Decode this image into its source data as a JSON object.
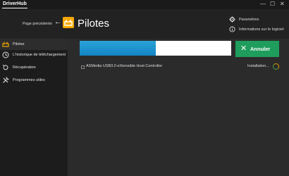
{
  "app": {
    "name": "DriverHub",
    "min": "—",
    "max": "☐",
    "close": "✕"
  },
  "header": {
    "back_label": "Page précédente",
    "title": "Pilotes",
    "settings_label": "Paramètres",
    "info_label": "Informations sur le logiciel"
  },
  "sidebar": {
    "items": [
      {
        "label": "Pilotes",
        "icon": "drivers-icon",
        "active": true
      },
      {
        "label": "L'historique de téléchargement",
        "icon": "history-icon",
        "active": false
      },
      {
        "label": "Récupération",
        "icon": "recovery-icon",
        "active": false
      },
      {
        "label": "Programmes utiles",
        "icon": "tools-icon",
        "active": false
      }
    ]
  },
  "main": {
    "progress": 0.5,
    "cancel_label": "Annuler",
    "drivers": [
      {
        "name": "ASMedia USB3.0 eXtensible Host Controller",
        "status": "Installation..."
      }
    ]
  },
  "colors": {
    "accent_blue": "#1b8fd0",
    "accent_green": "#1f9d5c",
    "brand_yellow": "#f5a800"
  }
}
